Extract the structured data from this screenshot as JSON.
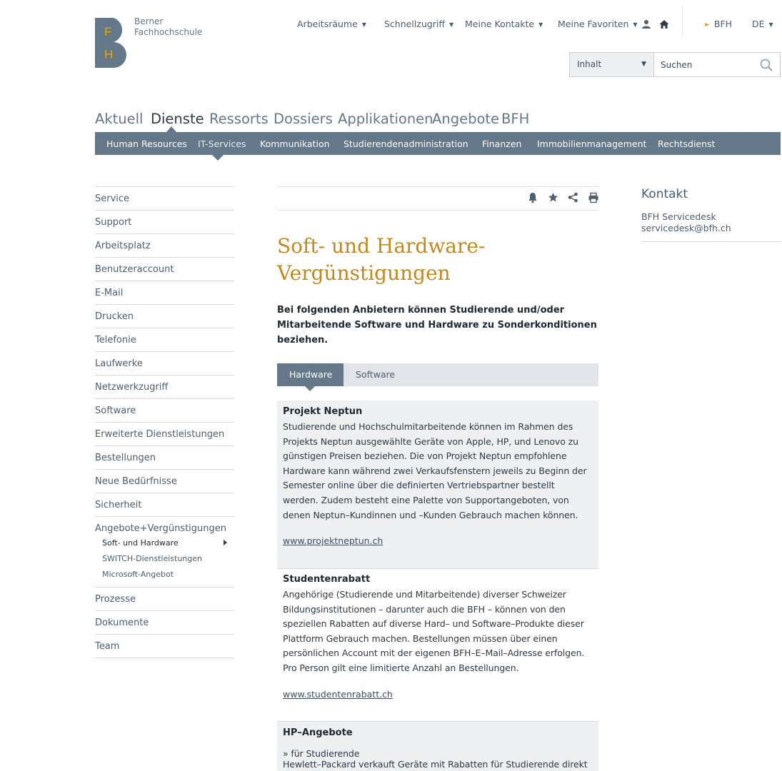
{
  "logo": {
    "letters": [
      "F",
      "H"
    ],
    "line1": "Berner",
    "line2": "Fachhochschule",
    "color": "#64788a",
    "accent": "#f0a30a"
  },
  "topnav": {
    "items": [
      "Arbeitsräume",
      "Schnellzugriff",
      "Meine Kontakte",
      "Meine Favoriten"
    ],
    "caret": "▼",
    "bfh": "BFH",
    "lang": "DE"
  },
  "search": {
    "scope": "Inhalt",
    "placeholder": "Suchen"
  },
  "mainnav": [
    "Aktuell",
    "Dienste",
    "Ressorts",
    "Dossiers",
    "Applikationen",
    "Angebote",
    "BFH"
  ],
  "subnav": [
    "Human Resources",
    "IT-Services",
    "Kommunikation",
    "Studierendenadministration",
    "Finanzen",
    "Immobilienmanagement",
    "Rechtsdienst"
  ],
  "sidebar": {
    "items_before": [
      "Service",
      "Support",
      "Arbeitsplatz",
      "Benutzeraccount",
      "E-Mail",
      "Drucken",
      "Telefonie",
      "Laufwerke",
      "Netzwerkzugriff",
      "Software",
      "Erweiterte Dienstleistungen",
      "Bestellungen",
      "Neue Bedürfnisse",
      "Sicherheit"
    ],
    "group": {
      "label": "Angebote+Vergünstigungen",
      "children": [
        "Soft- und Hardware",
        "SWITCH-Dienstleistungen",
        "Microsoft-Angebot"
      ]
    },
    "items_after": [
      "Prozesse",
      "Dokumente",
      "Team"
    ]
  },
  "content": {
    "title_line1": "Soft- und Hardware-",
    "title_line2": "Vergünstigungen",
    "lead": "Bei folgenden Anbietern können Studierende und/oder Mitarbeitende Software und Hardware zu Sonderkonditionen beziehen.",
    "tabs": [
      "Hardware",
      "Software"
    ],
    "cards": [
      {
        "title": "Projekt Neptun",
        "body": "Studierende und Hochschulmitarbeitende können im Rahmen des Projekts Neptun ausgewählte Geräte von Apple, HP, und Lenovo zu günstigen Preisen beziehen. Die von Projekt Neptun empfohlene Hardware kann während zwei Verkaufsfenstern jeweils zu Beginn der Semester online über die definierten Vertriebspartner bestellt werden. Zudem besteht eine Palette von Supportangeboten, von denen Neptun–Kundinnen und –Kunden Gebrauch machen können.",
        "link": "www.projektneptun.ch"
      },
      {
        "title": "Studentenrabatt",
        "body": "Angehörige (Studierende und Mitarbeitende) diverser Schweizer Bildungsinstitutionen – darunter auch die BFH – können von den speziellen Rabatten auf diverse Hard– und Software–Produkte dieser Plattform Gebrauch machen. Bestellungen müssen über einen persönlichen Account mit der eigenen BFH–E–Mail–Adresse erfolgen. Pro Person gilt eine limitierte Anzahl an Bestellungen.",
        "link": "www.studentenrabatt.ch"
      },
      {
        "title": "HP–Angebote",
        "sub": "» für Studierende",
        "body": "Hewlett–Packard verkauft Geräte mit Rabatten für Studierende direkt"
      }
    ]
  },
  "contact": {
    "title": "Kontakt",
    "line1": "BFH Servicedesk",
    "line2": "servicedesk@bfh.ch"
  }
}
